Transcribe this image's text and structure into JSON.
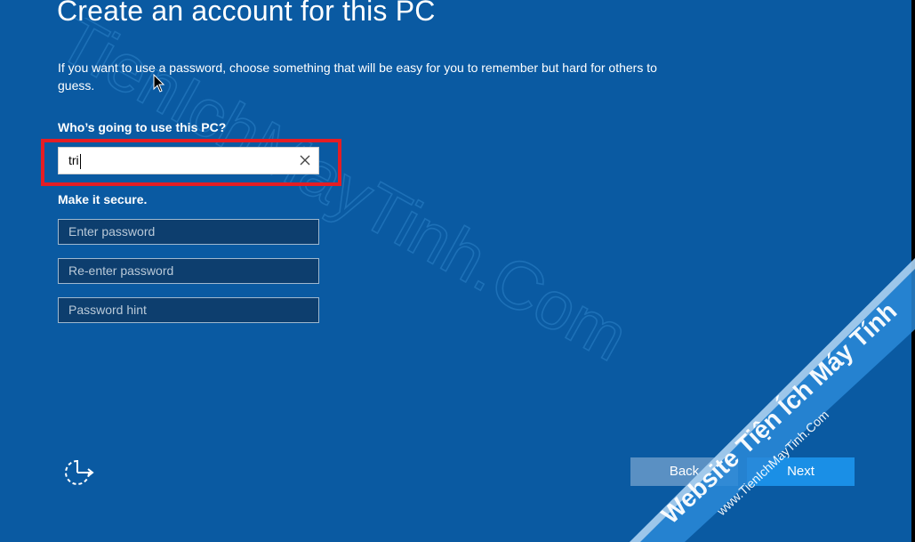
{
  "page": {
    "title": "Create an account for this PC",
    "description": "If you want to use a password, choose something that will be easy for you to remember but hard for others to guess."
  },
  "form": {
    "username_label": "Who’s going to use this PC?",
    "username_value": "tri",
    "secure_label": "Make it secure.",
    "password_placeholder": "Enter password",
    "reenter_placeholder": "Re-enter password",
    "hint_placeholder": "Password hint"
  },
  "buttons": {
    "back": "Back",
    "next": "Next"
  },
  "watermark": {
    "center_text": "TienIchMayTinh.Com",
    "ribbon_title": "Website Tiện Ích Máy Tính",
    "ribbon_url": "www.TienIchMayTinh.Com"
  },
  "icons": {
    "clear": "clear-x-icon",
    "accessibility": "ease-of-access-icon",
    "cursor": "mouse-pointer-icon"
  },
  "colors": {
    "background": "#0a5aa2",
    "highlight": "#e51d24",
    "next_button": "#1a8fe6",
    "back_button": "#5a90c3"
  }
}
